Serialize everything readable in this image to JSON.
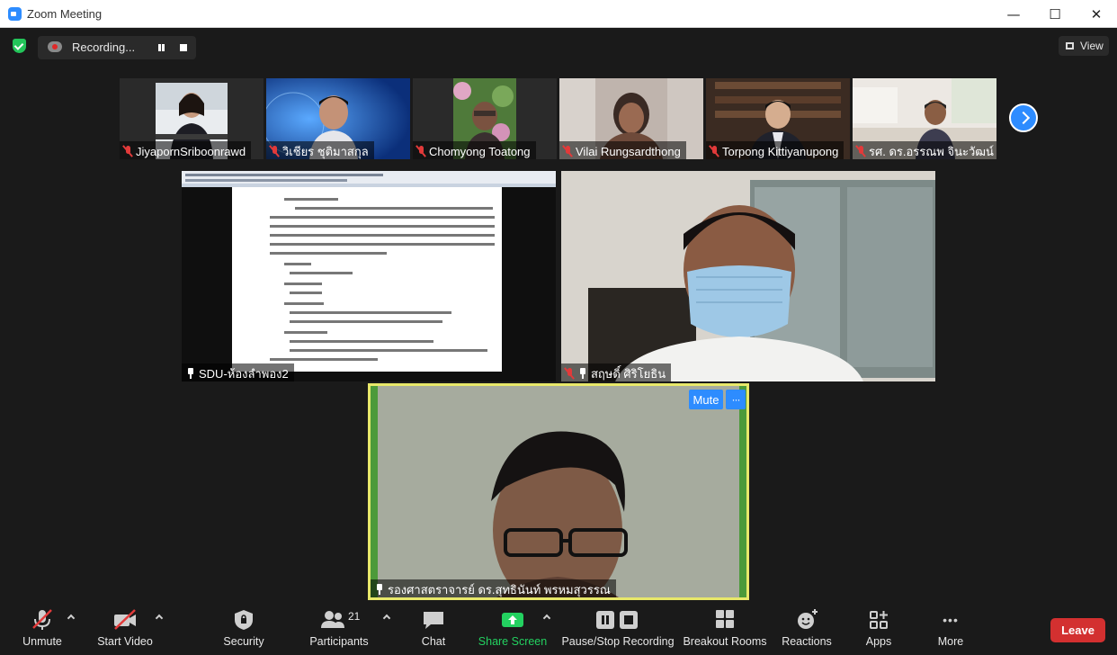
{
  "window": {
    "title": "Zoom Meeting",
    "minimize_glyph": "—",
    "maximize_glyph": "☐",
    "close_glyph": "✕"
  },
  "recording": {
    "label": "Recording..."
  },
  "view": {
    "label": "View"
  },
  "thumbnails": [
    {
      "name": "JiyapornSriboonrawd",
      "muted": true
    },
    {
      "name": "วิเชียร ชุติมาสกุล",
      "muted": true
    },
    {
      "name": "Chomyong Toatong",
      "muted": true
    },
    {
      "name": "Vilai Rungsardthong",
      "muted": true
    },
    {
      "name": "Torpong Kittiyanupong",
      "muted": true
    },
    {
      "name": "รศ. ดร.อรรณพ จินะวัฒน์",
      "muted": true
    }
  ],
  "tiles": {
    "share": {
      "name": "SDU-ห้องลำพอง2"
    },
    "masked": {
      "name": "สฤษดิ์ ศิริโยธิน"
    },
    "speaker": {
      "name": "รองศาสตราจารย์ ดร.สุทธินันท์ พรหมสุวรรณ",
      "mute_label": "Mute",
      "more_label": "···"
    }
  },
  "toolbar": {
    "unmute": "Unmute",
    "start_video": "Start Video",
    "security": "Security",
    "participants": "Participants",
    "participants_count": "21",
    "chat": "Chat",
    "share_screen": "Share Screen",
    "pause_stop_recording": "Pause/Stop Recording",
    "breakout_rooms": "Breakout Rooms",
    "reactions": "Reactions",
    "apps": "Apps",
    "more": "More",
    "more_glyph": "•••",
    "leave": "Leave"
  },
  "colors": {
    "accent": "#2d8cff",
    "active_speaker_border": "#e8e86a",
    "leave": "#d33030",
    "share_green": "#23d160",
    "muted_red": "#e23a3a"
  }
}
